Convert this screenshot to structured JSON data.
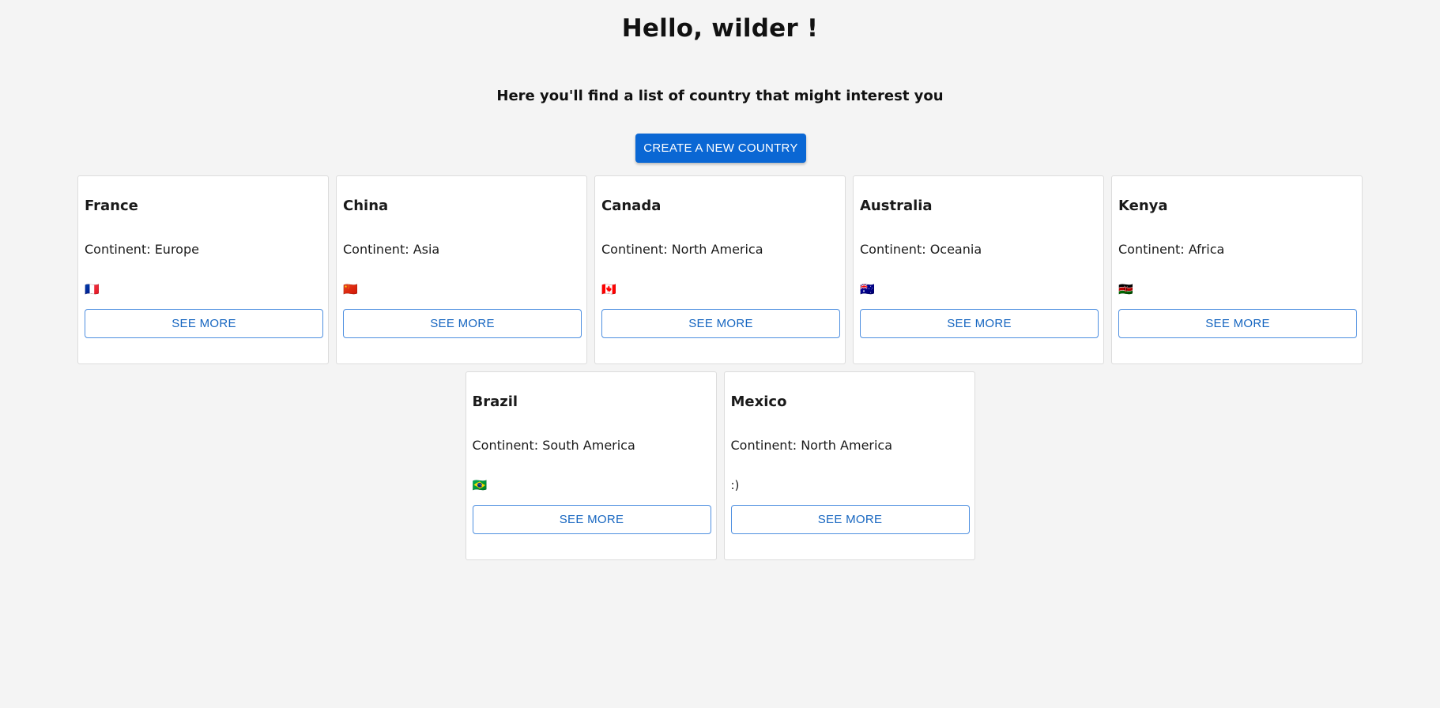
{
  "header": {
    "greeting": "Hello, wilder !",
    "subtitle": "Here you'll find a list of country that might interest you",
    "create_button_label": "CREATE A NEW COUNTRY"
  },
  "see_more_label": "SEE MORE",
  "colors": {
    "background": "#f4f4f4",
    "primary": "#0a67d4",
    "outline_button_text": "#1565c0"
  },
  "countries": [
    {
      "name": "France",
      "continent": "Continent: Europe",
      "flag": "🇫🇷"
    },
    {
      "name": "China",
      "continent": "Continent: Asia",
      "flag": "🇨🇳"
    },
    {
      "name": "Canada",
      "continent": "Continent: North America",
      "flag": "🇨🇦"
    },
    {
      "name": "Australia",
      "continent": "Continent: Oceania",
      "flag": "🇦🇺"
    },
    {
      "name": "Kenya",
      "continent": "Continent: Africa",
      "flag": "🇰🇪"
    },
    {
      "name": "Brazil",
      "continent": "Continent: South America",
      "flag": "🇧🇷"
    },
    {
      "name": "Mexico",
      "continent": "Continent: North America",
      "flag": ":)"
    }
  ]
}
